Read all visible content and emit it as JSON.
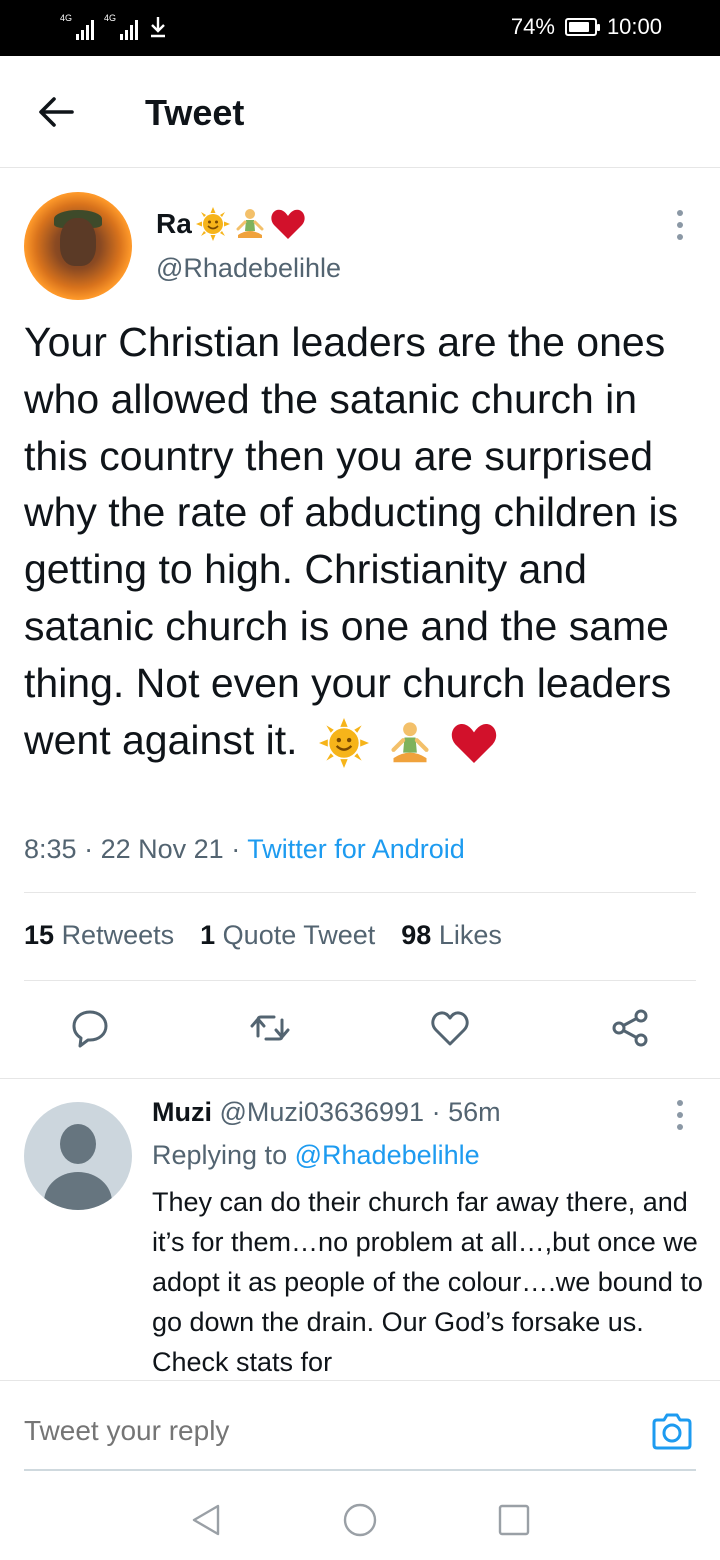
{
  "status_bar": {
    "network1": "4G",
    "network2": "4G",
    "battery": "74%",
    "time": "10:00"
  },
  "header": {
    "title": "Tweet"
  },
  "tweet": {
    "author_name": "Ra",
    "author_handle": "@Rhadebelihle",
    "text": "Your Christian leaders are the ones who allowed the satanic church in this country then you are surprised why the rate of abducting children is getting to high. Christianity and satanic church is one and the same thing. Not even your church leaders went against it.",
    "time": "8:35",
    "date": "22 Nov 21",
    "source": "Twitter for Android",
    "stats": {
      "retweets_count": "15",
      "retweets_label": "Retweets",
      "quotes_count": "1",
      "quotes_label": "Quote Tweet",
      "likes_count": "98",
      "likes_label": "Likes"
    }
  },
  "reply": {
    "name": "Muzi",
    "handle": "@Muzi03636991",
    "age": "56m",
    "replying_prefix": "Replying to",
    "replying_to": "@Rhadebelihle",
    "text": "They can do their church far away there, and it’s for them…no problem at all…,but once we adopt it as people of the colour….we bound to go down the drain. Our God’s forsake us. Check stats for"
  },
  "composer": {
    "placeholder": "Tweet your reply"
  },
  "icons": {
    "back": "arrow-left-icon",
    "reply": "reply-icon",
    "retweet": "retweet-icon",
    "like": "heart-icon",
    "share": "share-icon",
    "camera": "camera-icon"
  },
  "colors": {
    "accent": "#1d9bf0",
    "secondary_text": "#536471",
    "heart_emoji": "#d2112b"
  }
}
